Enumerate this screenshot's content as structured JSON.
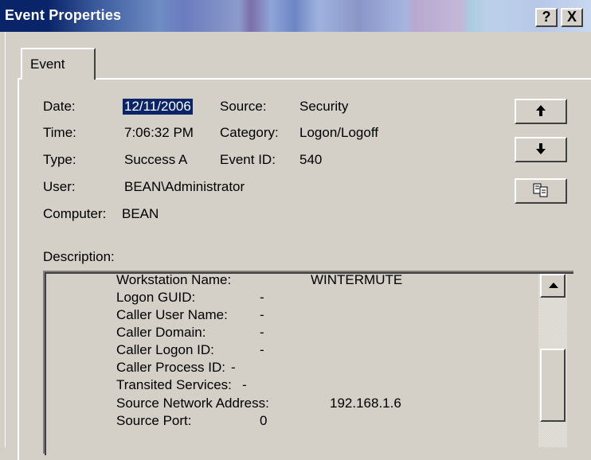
{
  "window": {
    "title": "Event Properties",
    "help_label": "?",
    "close_label": "X"
  },
  "tabs": [
    {
      "label": "Event"
    }
  ],
  "fields": {
    "date_label": "Date:",
    "date_value": "12/11/2006",
    "source_label": "Source:",
    "source_value": "Security",
    "time_label": "Time:",
    "time_value": "7:06:32 PM",
    "category_label": "Category:",
    "category_value": "Logon/Logoff",
    "type_label": "Type:",
    "type_value": "Success A",
    "eventid_label": "Event ID:",
    "eventid_value": "540",
    "user_label": "User:",
    "user_value": "BEAN\\Administrator",
    "computer_label": "Computer:",
    "computer_value": "BEAN"
  },
  "description": {
    "label": "Description:",
    "lines": [
      {
        "key": "Workstation Name:",
        "value": "WINTERMUTE"
      },
      {
        "key": "Logon GUID:",
        "value": "-"
      },
      {
        "key": "Caller User Name:",
        "value": "-"
      },
      {
        "key": "Caller Domain:",
        "value": "-"
      },
      {
        "key": "Caller Logon ID:",
        "value": "-"
      },
      {
        "key": "Caller Process ID:",
        "value": "-"
      },
      {
        "key": "Transited Services:",
        "value": "-"
      },
      {
        "key": "Source Network Address:",
        "value": "192.168.1.6"
      },
      {
        "key": "Source Port:",
        "value": "0"
      }
    ]
  },
  "buttons": {
    "previous": {
      "icon": "up-arrow-icon",
      "glyph": "🠕"
    },
    "next": {
      "icon": "down-arrow-icon",
      "glyph": "🠗"
    },
    "copy": {
      "icon": "copy-icon"
    }
  },
  "colors": {
    "face": "#d4d0c8",
    "selection": "#0a246a",
    "title_text": "#ffffff"
  }
}
